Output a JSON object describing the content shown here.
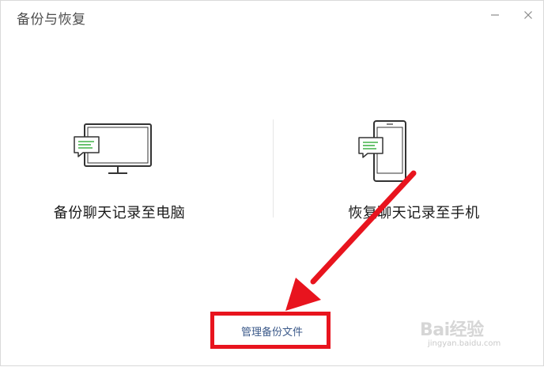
{
  "window": {
    "title": "备份与恢复",
    "minimize_icon": "minimize-icon",
    "close_icon": "close-icon"
  },
  "options": [
    {
      "label": "备份聊天记录至电脑",
      "icon": "monitor-chat-icon",
      "accent": "#42b349"
    },
    {
      "label": "恢复聊天记录至手机",
      "icon": "phone-chat-icon",
      "accent": "#42b349"
    }
  ],
  "footer": {
    "manage_label": "管理备份文件",
    "link_color": "#3c5a8a"
  },
  "annotation": {
    "color": "#e8141e",
    "arrow_icon": "arrow-icon"
  },
  "watermark": {
    "brand": "Bai经验",
    "site": "jingyan.baidu.com"
  }
}
